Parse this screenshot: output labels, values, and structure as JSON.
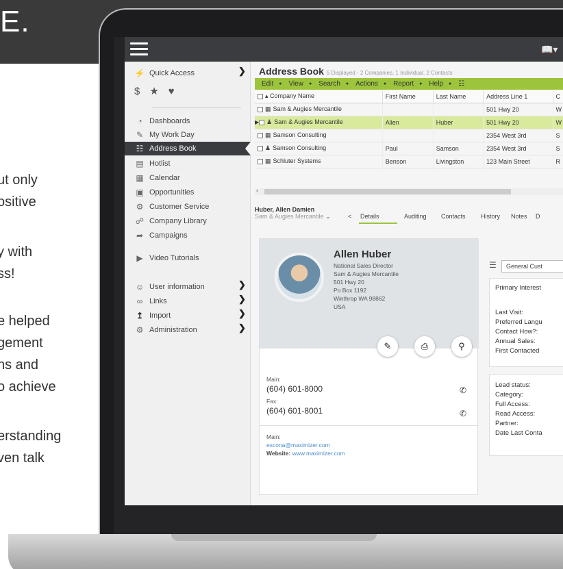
{
  "banner": {
    "letter": "E."
  },
  "bleed_text": [
    "ut only",
    "ositive",
    "y with",
    "ss!",
    "e helped",
    "gement",
    "ns and",
    "o achieve",
    "erstanding",
    "ven talk"
  ],
  "sidebar": {
    "quick_access": "Quick Access",
    "items": [
      {
        "label": "Dashboards",
        "icon": "dashboard-icon"
      },
      {
        "label": "My Work Day",
        "icon": "pencil-icon"
      },
      {
        "label": "Address Book",
        "icon": "book-icon"
      },
      {
        "label": "Hotlist",
        "icon": "hotlist-icon"
      },
      {
        "label": "Calendar",
        "icon": "calendar-icon"
      },
      {
        "label": "Opportunities",
        "icon": "opportunity-icon"
      },
      {
        "label": "Customer Service",
        "icon": "service-icon"
      },
      {
        "label": "Company Library",
        "icon": "library-icon"
      },
      {
        "label": "Campaigns",
        "icon": "campaign-icon"
      },
      {
        "label": "Video Tutorials",
        "icon": "video-icon"
      },
      {
        "label": "User information",
        "icon": "user-icon"
      },
      {
        "label": "Links",
        "icon": "link-icon"
      },
      {
        "label": "Import",
        "icon": "import-icon"
      },
      {
        "label": "Administration",
        "icon": "gear-icon"
      }
    ]
  },
  "addressbook": {
    "title": "Address Book",
    "subtitle": "5 Displayed - 2 Companies, 1 Individual, 2 Contacts",
    "toolbar": [
      "Edit",
      "View",
      "Search",
      "Actions",
      "Report",
      "Help"
    ],
    "columns": [
      "Company Name",
      "First Name",
      "Last Name",
      "Address Line 1",
      "C"
    ],
    "rows": [
      {
        "company": "Sam & Augies Mercantile",
        "first": "",
        "last": "",
        "address": "501 Hwy 20",
        "c": "W"
      },
      {
        "company": "Sam & Augies Mercantile",
        "first": "Allen",
        "last": "Huber",
        "address": "501 Hwy 20",
        "c": "W"
      },
      {
        "company": "Samson Consulting",
        "first": "",
        "last": "",
        "address": "2354 West 3rd",
        "c": "S"
      },
      {
        "company": "Samson Consulting",
        "first": "Paul",
        "last": "Samson",
        "address": "2354 West 3rd",
        "c": "S"
      },
      {
        "company": "Schluter Systems",
        "first": "Benson",
        "last": "Livingston",
        "address": "123 Main Street",
        "c": "R"
      }
    ]
  },
  "contact": {
    "header_name": "Huber, Allen Damien",
    "header_company": "Sam & Augies Mercantile",
    "tabs": [
      "Details",
      "Auditing",
      "Contacts",
      "History",
      "Notes",
      "D"
    ],
    "name": "Allen Huber",
    "lines": [
      "National Sales Director",
      "Sam & Augies Mercantile",
      "501 Hwy 20",
      "Po Box 1192",
      "Winthrop WA 98862",
      "USA"
    ],
    "main_label": "Main:",
    "main_phone": "(604) 601-8000",
    "fax_label": "Fax:",
    "fax_phone": "(604) 601-8001",
    "email_label": "Main:",
    "email": "escona@maximizer.com",
    "website_label": "Website:",
    "website": "www.maximizer.com"
  },
  "right_panel": {
    "select": "General Cust",
    "p1": [
      "Primary Interest",
      "Last Visit:",
      "Preferred Langu",
      "Contact How?:",
      "Annual Sales:",
      "First Contacted"
    ],
    "p2": [
      "Lead status:",
      "Category:",
      "Full Access:",
      "Read Access:",
      "Partner:",
      "Date Last Conta"
    ]
  },
  "colors": {
    "accent": "#9cc43c",
    "highlight": "#d9ea9c",
    "dark": "#3a3c3f"
  }
}
